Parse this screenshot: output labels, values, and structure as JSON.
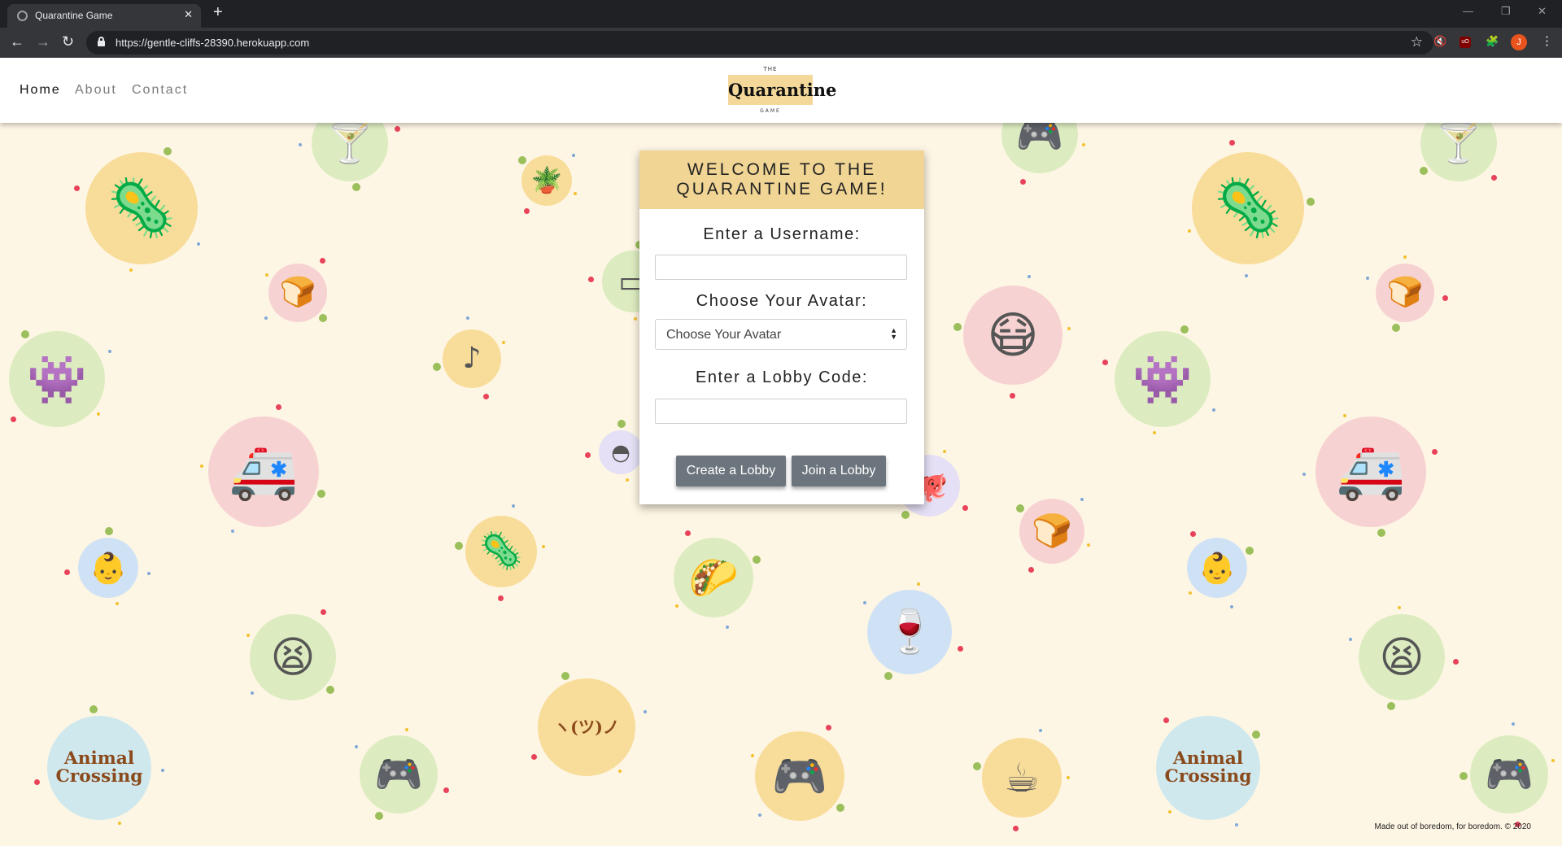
{
  "browser": {
    "tab_title": "Quarantine Game",
    "tab_close": "✕",
    "new_tab": "+",
    "url": "https://gentle-cliffs-28390.herokuapp.com",
    "profile_initial": "J",
    "ublock_label": "uO"
  },
  "nav": {
    "links": [
      "Home",
      "About",
      "Contact"
    ],
    "active": "Home"
  },
  "logo": {
    "top": "THE",
    "main": "Quarantine",
    "bottom": "GAME"
  },
  "card": {
    "title": "WELCOME TO THE QUARANTINE GAME!",
    "username_label": "Enter a Username:",
    "username_value": "",
    "avatar_label": "Choose Your Avatar:",
    "avatar_selected": "Choose Your Avatar",
    "lobby_label": "Enter a Lobby Code:",
    "lobby_value": "",
    "create_button": "Create a Lobby",
    "join_button": "Join a Lobby"
  },
  "footer": {
    "note": "Made out of boredom, for boredom. © 2020"
  },
  "background_icons": [
    {
      "name": "covid-virus-icon",
      "glyph": "🦠",
      "bg": "#f8dc9a"
    },
    {
      "name": "cocktail-icon",
      "glyph": "🍸",
      "bg": "#dcecc0"
    },
    {
      "name": "potted-plant-icon",
      "glyph": "🪴",
      "bg": "#f8dc9a"
    },
    {
      "name": "game-controller-icon",
      "glyph": "🎮",
      "bg": "#dcecc0"
    },
    {
      "name": "toast-icon",
      "glyph": "🍞",
      "bg": "#f7d2d2"
    },
    {
      "name": "among-us-icon",
      "glyph": "👾",
      "bg": "#dcecc0"
    },
    {
      "name": "tiktok-icon",
      "glyph": "♪",
      "bg": "#f8dc9a"
    },
    {
      "name": "masked-face-icon",
      "glyph": "😷",
      "bg": "#f7d2d2"
    },
    {
      "name": "ambulance-icon",
      "glyph": "🚑",
      "bg": "#f7d2d2"
    },
    {
      "name": "pokeball-icon",
      "glyph": "◓",
      "bg": "#e5e0f5"
    },
    {
      "name": "baby-icon",
      "glyph": "👶",
      "bg": "#cfe2f5"
    },
    {
      "name": "taco-icon",
      "glyph": "🌮",
      "bg": "#dcecc0"
    },
    {
      "name": "wine-glass-icon",
      "glyph": "🍷",
      "bg": "#cfe2f5"
    },
    {
      "name": "rage-face-icon",
      "glyph": "😫",
      "bg": "#dcecc0"
    },
    {
      "name": "kaomoji-icon",
      "glyph": "ヽ(ツ)ノ",
      "bg": "#f8dc9a"
    },
    {
      "name": "animal-crossing-icon",
      "glyph": "Animal Crossing",
      "bg": "#cfe8ee"
    },
    {
      "name": "switch-controller-icon",
      "glyph": "🎮",
      "bg": "#f8dc9a"
    },
    {
      "name": "coffee-cup-icon",
      "glyph": "☕",
      "bg": "#f8dc9a"
    },
    {
      "name": "github-octocat-icon",
      "glyph": "🐙",
      "bg": "#e5e0f5"
    },
    {
      "name": "tablet-icon",
      "glyph": "▭",
      "bg": "#dcecc0"
    }
  ]
}
